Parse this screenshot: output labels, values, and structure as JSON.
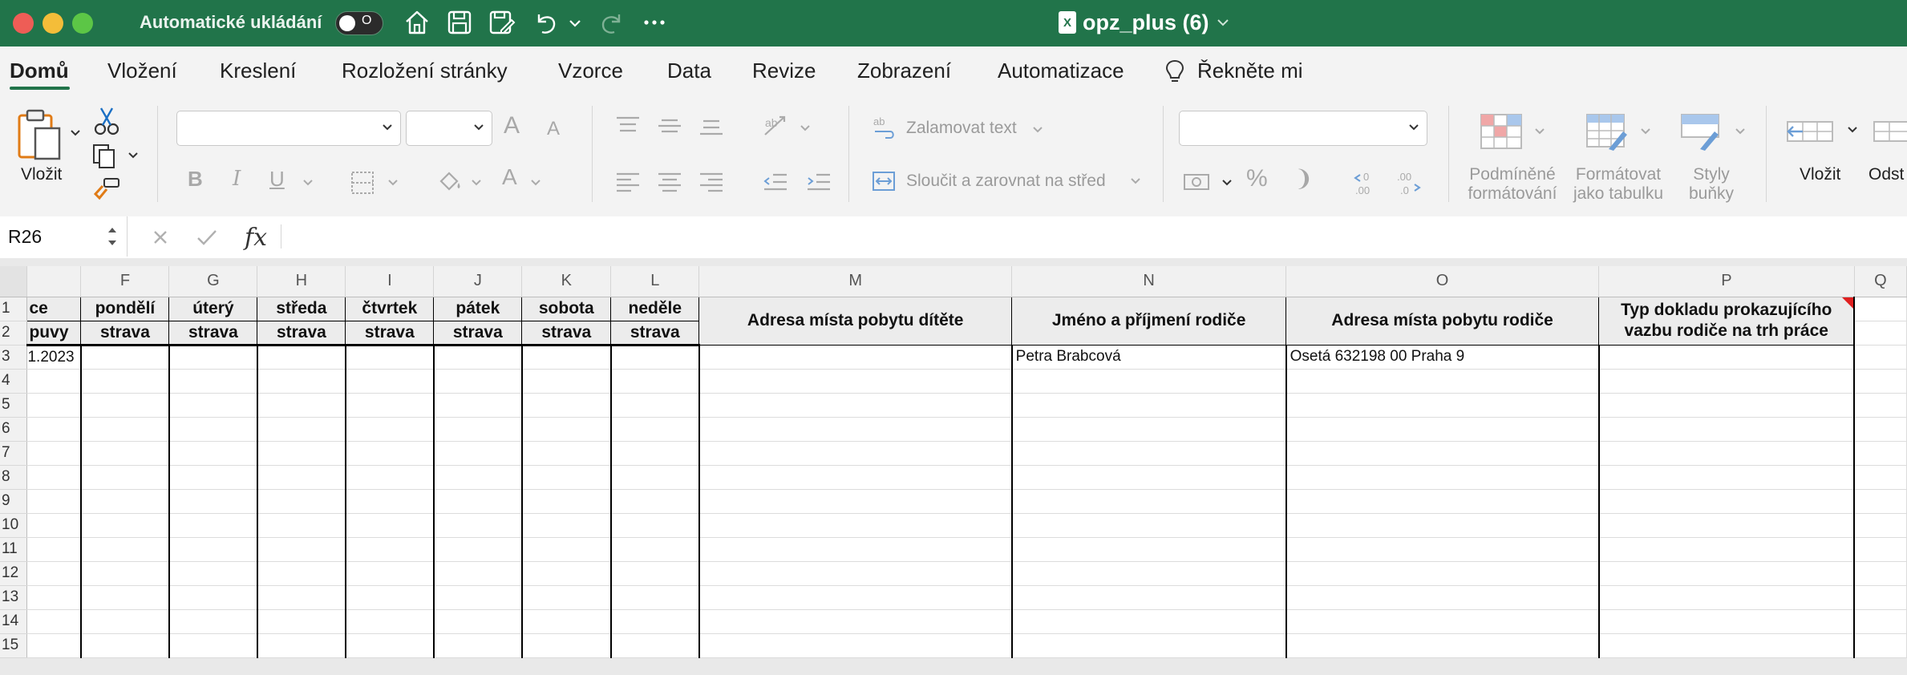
{
  "window": {
    "autosave_label": "Automatické ukládání",
    "autosave_state": "O",
    "doc_title": "opz_plus (6)",
    "doc_icon": "X"
  },
  "menu": {
    "tabs": [
      {
        "label": "Domů",
        "active": true
      },
      {
        "label": "Vložení"
      },
      {
        "label": "Kreslení"
      },
      {
        "label": "Rozložení stránky"
      },
      {
        "label": "Vzorce"
      },
      {
        "label": "Data"
      },
      {
        "label": "Revize"
      },
      {
        "label": "Zobrazení"
      },
      {
        "label": "Automatizace"
      },
      {
        "label": "Řekněte mi"
      }
    ]
  },
  "ribbon": {
    "paste_label": "Vložit",
    "font_name": "",
    "font_size": "",
    "bold": "B",
    "italic": "I",
    "underline": "U",
    "font_color": "A",
    "grow_font": "A",
    "shrink_font": "A",
    "wrap_text": "Zalamovat text",
    "merge_center": "Sloučit a zarovnat na střed",
    "number_format": "",
    "percent": "%",
    "comma": "❩",
    "decimals_inc": ".00",
    "decimals_dec": ".0",
    "cond_format": "Podmíněné\nformátování",
    "cond_format_l1": "Podmíněné",
    "cond_format_l2": "formátování",
    "table_format_l1": "Formátovat",
    "table_format_l2": "jako tabulku",
    "cell_styles_l1": "Styly",
    "cell_styles_l2": "buňky",
    "insert_label": "Vložit",
    "delete_label": "Odst"
  },
  "formula_bar": {
    "name_box": "R26",
    "fx": "fx",
    "value": ""
  },
  "sheet": {
    "columns": [
      "",
      "F",
      "G",
      "H",
      "I",
      "J",
      "K",
      "L",
      "M",
      "N",
      "O",
      "P",
      "Q"
    ],
    "row_numbers": [
      "1",
      "2",
      "3",
      "4",
      "5",
      "6",
      "7",
      "8",
      "9",
      "10",
      "11",
      "12",
      "13",
      "14",
      "15"
    ],
    "header_row1": [
      "ce",
      "pondělí",
      "úterý",
      "středa",
      "čtvrtek",
      "pátek",
      "sobota",
      "neděle"
    ],
    "header_row2": [
      "puvy",
      "strava",
      "strava",
      "strava",
      "strava",
      "strava",
      "strava",
      "strava"
    ],
    "header_merged": {
      "M": "Adresa místa pobytu dítěte",
      "N": "Jméno a příjmení rodiče",
      "O": "Adresa místa pobytu rodiče",
      "P_line1": "Typ dokladu prokazujícího",
      "P_line2": "vazbu rodiče na trh práce"
    },
    "row3": {
      "E": "1.2023",
      "N": "Petra Brabcová",
      "O": "Osetá 632198 00 Praha 9"
    }
  },
  "colors": {
    "titlebar": "#21744a",
    "accent": "#21744a",
    "comment_indicator": "#e02020"
  }
}
